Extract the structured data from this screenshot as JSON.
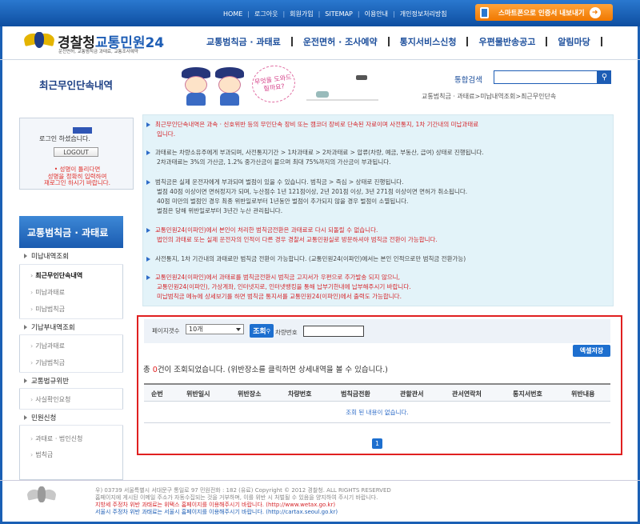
{
  "top_links": [
    "HOME",
    "로그아웃",
    "회원가입",
    "SITEMAP",
    "이용안내",
    "개인정보처리방침"
  ],
  "smart_button": "스마트폰으로 인증서 내보내기",
  "logo": {
    "title_dark": "경찰청",
    "title_blue": "교통민원24",
    "subtitle": "운전면허, 교통범칙금 과태료, 교통조사예약"
  },
  "main_nav": [
    "교통범칙금 · 과태료",
    "운전면허 · 조사예약",
    "통지서비스신청",
    "우편물반송공고",
    "알림마당"
  ],
  "page_title": "최근무인단속내역",
  "banner_bubble": "무엇을 도와드릴까요?",
  "search": {
    "label": "통합검색",
    "value": ""
  },
  "breadcrumb": "교통범칙금 · 과태료>미납내역조회>최근무인단속",
  "login": {
    "message": "로그인 하셨습니다.",
    "logout": "LOGOUT",
    "warn1": "• 성명이 틀리다면",
    "warn2": "성명을 정확히 입력하여",
    "warn3": "재로그인 하시기 바랍니다."
  },
  "side_menu": {
    "heading": "교통범칙금 · 과태료",
    "items": [
      {
        "label": "미납내역조회",
        "type": "major"
      },
      {
        "label": "최근무인단속내역",
        "type": "minor",
        "active": true
      },
      {
        "label": "미납과태료",
        "type": "minor"
      },
      {
        "label": "미납범칙금",
        "type": "minor"
      },
      {
        "label": "기납부내역조회",
        "type": "major"
      },
      {
        "label": "기납과태료",
        "type": "minor"
      },
      {
        "label": "기납범칙금",
        "type": "minor"
      },
      {
        "label": "교통법규위반",
        "type": "major"
      },
      {
        "label": "사실확인요청",
        "type": "minor"
      },
      {
        "label": "민원신청",
        "type": "major"
      },
      {
        "label": "과태료 · 법인신청",
        "type": "minor"
      },
      {
        "label": "범칙금",
        "type": "minor"
      }
    ]
  },
  "notice": {
    "n1a": "최근무인단속내역은 과속 · 신호위반 등의 무인단속 장비 또는 캠코더 장비로 단속된 자료이며 사전통지, 1차 기간내의 미납과태료",
    "n1b": "입니다.",
    "n2a": "과태료는 차량소유주에게 부과되며, 사전통지기간 > 1차과태료 > 2차과태료 > 압류(차량, 예금, 부동산, 급여) 상태로 진행됩니다.",
    "n2b": "2차과태료는 3%의 가산금, 1.2% 중가산금이 붙으며 최대 75%까지의 가산금이 부과됩니다.",
    "n3a": "범칙금은 실제 운전자에게 부과되며 벌점이 있을 수 있습니다. 범칙금 > 즉심 > 상태로 진행됩니다.",
    "n3b": "벌점 40점 이상이면 면허정지가 되며, 누산점수 1년 121점이상, 2년 201점 이상, 3년 271점 이상이면 면허가 취소됩니다.",
    "n3c": "40점 미만의 벌점인 경우 최종 위반일로부터 1년동안 벌점이 추가되지 않을 경우 벌점이 소멸됩니다.",
    "n3d": "벌점은 당해 위반일로부터 3년간 누산 관리됩니다.",
    "n4a": "교통민원24(이파인)에서 본인이 처리한 범칙금전환은 과태료로 다시 되돌릴 수 없습니다.",
    "n4b": "법인의 과태료 또는 실제 운전자의 인적이 다른 경우 경찰서 교통민원실로 방문하셔야 범칙금 전환이 가능합니다.",
    "n5a": "사전통지, 1차 기간내의 과태료만 범칙금 전환이 가능합니다. (교통민원24(이파인)에서는 본인 인적으로만 범칙금 전환가능)",
    "n6a": "교통민원24(이파인)에서 과태료를 범칙금전환시 범칙금 고지서가 우편으로 추가발송 되지 않으니,",
    "n6b": "교통민원24(이파인), 가상계좌, 인터넷지로, 인터넷뱅킹을 통해 납부기한내에 납부해주시기 바랍니다.",
    "n6c": "미납범칙금 메뉴에 상세보기를 하면 범칙금 통지서를 교통민원24(이파인)에서 출력도 가능합니다."
  },
  "filter": {
    "page_count_label": "페이지갯수",
    "page_count_value": "10개",
    "search_button": "조회",
    "plate_label": "차량번호",
    "excel_button": "엑셀저장"
  },
  "results": {
    "count_prefix": "총 ",
    "count": "0",
    "count_suffix": "건이 조회되었습니다. (위반장소를 클릭하면 상세내역을 볼 수 있습니다.)",
    "columns": [
      "순번",
      "위반일시",
      "위반장소",
      "차량번호",
      "범칙금전환",
      "관할관서",
      "관서연락처",
      "통지서번호",
      "위반내용"
    ],
    "empty": "조회 된 내용이 없습니다.",
    "page": "1"
  },
  "footer": {
    "line1": "우) 03739 서울특별시 서대문구 통일로 97  민원전화 : 182 (유료)      Copyright © 2012 경찰청. ALL RIGHTS RESERVED",
    "line2": "홈페이지에 게시된 이메일 주소가 자동수집되는 것을 거부하며, 이를 위반 시 처벌될 수 있음을 양지하여 주시기 바랍니다.",
    "line3": "지방세 주정차 위반 과태료는 위택스 홈페이지를 이용해주시기 바랍니다. (http://www.wetax.go.kr)",
    "line4": "서울시 주정차 위반 과태료는 서울시 홈페이지를 이용해주시기 바랍니다. (http://cartax.seoul.go.kr)"
  }
}
